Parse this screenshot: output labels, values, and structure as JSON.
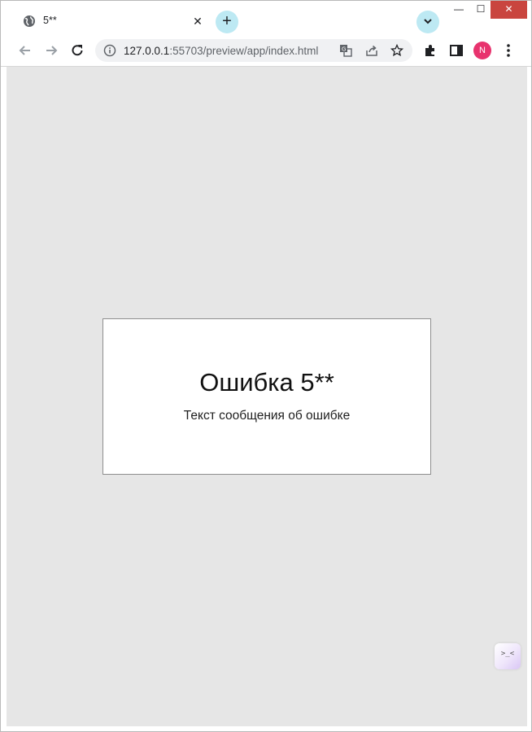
{
  "browser": {
    "tab": {
      "title": "5**",
      "close_label": "✕"
    },
    "new_tab_label": "+",
    "window_controls": {
      "minimize": "—",
      "maximize": "☐",
      "close": "✕"
    },
    "address": {
      "host": "127.0.0.1",
      "rest": ":55703/preview/app/index.html"
    },
    "profile_initial": "N",
    "icons": [
      "globe-icon",
      "back-icon",
      "forward-icon",
      "reload-icon",
      "info-icon",
      "translate-icon",
      "share-icon",
      "star-icon",
      "extensions-icon",
      "side-panel-icon",
      "menu-icon",
      "tab-search-icon"
    ]
  },
  "page": {
    "error_title": "Ошибка 5**",
    "error_message": "Текст сообщения об ошибке",
    "widget_glyph": ">_<"
  },
  "colors": {
    "page_background": "#e6e6e6",
    "card_background": "#ffffff",
    "close_button": "#c9453f",
    "accent_circle": "#bde9f3",
    "avatar": "#e8336e"
  }
}
